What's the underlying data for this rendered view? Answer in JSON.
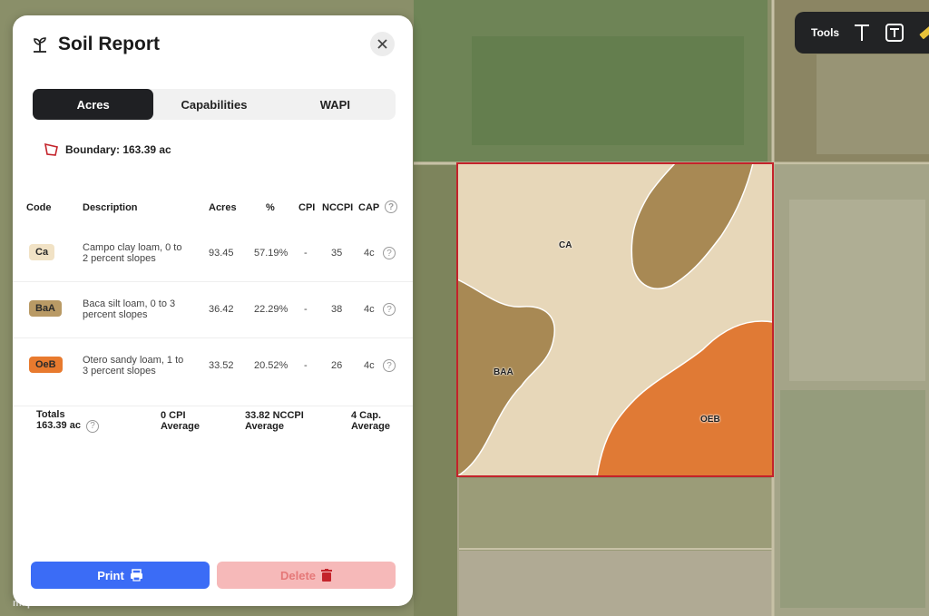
{
  "panel": {
    "title": "Soil Report",
    "tabs": [
      {
        "label": "Acres",
        "active": true
      },
      {
        "label": "Capabilities",
        "active": false
      },
      {
        "label": "WAPI",
        "active": false
      }
    ],
    "boundary_text": "Boundary: 163.39 ac",
    "table": {
      "headers": {
        "code": "Code",
        "description": "Description",
        "acres": "Acres",
        "percent": "%",
        "cpi": "CPI",
        "nccpi": "NCCPI",
        "cap": "CAP"
      },
      "rows": [
        {
          "code": "Ca",
          "code_color": "#f1e2c5",
          "desc1": "Campo clay loam, 0 to",
          "desc2": "2 percent slopes",
          "acres": "93.45",
          "percent": "57.19%",
          "cpi": "-",
          "nccpi": "35",
          "cap": "4c"
        },
        {
          "code": "BaA",
          "code_color": "#b99a65",
          "desc1": "Baca silt loam, 0 to 3",
          "desc2": "percent slopes",
          "acres": "36.42",
          "percent": "22.29%",
          "cpi": "-",
          "nccpi": "38",
          "cap": "4c"
        },
        {
          "code": "OeB",
          "code_color": "#e87a2e",
          "desc1": "Otero sandy loam, 1 to",
          "desc2": "3 percent slopes",
          "acres": "33.52",
          "percent": "20.52%",
          "cpi": "-",
          "nccpi": "26",
          "cap": "4c"
        }
      ]
    },
    "totals": {
      "label": "Totals",
      "acres": "163.39 ac",
      "cpi_line1": "0 CPI",
      "cpi_line2": "Average",
      "nccpi_line1": "33.82 NCCPI",
      "nccpi_line2": "Average",
      "cap_line1": "4 Cap.",
      "cap_line2": "Average"
    },
    "print_label": "Print",
    "delete_label": "Delete",
    "help_glyph": "?"
  },
  "tools": {
    "label": "Tools"
  },
  "map": {
    "labels": {
      "ca": "CA",
      "baa": "BAA",
      "oeb": "OEB"
    },
    "boundary_color": "#c4232b",
    "colors": {
      "ca": "#e7d7b9",
      "baa": "#a78957",
      "oeb": "#e07a35"
    },
    "attribution": "mapbox"
  }
}
